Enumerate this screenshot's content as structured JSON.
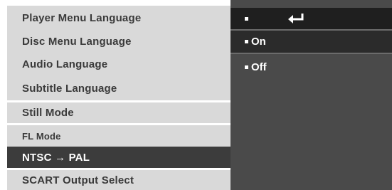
{
  "menu": {
    "items": [
      {
        "label": "Player Menu Language"
      },
      {
        "label": "Disc Menu Language"
      },
      {
        "label": "Audio Language"
      },
      {
        "label": "Subtitle Language"
      },
      {
        "label": "Still Mode"
      },
      {
        "label": "FL Mode"
      },
      {
        "label": "NTSC → PAL"
      },
      {
        "label": "SCART Output Select"
      }
    ],
    "selected_item": "NTSC → PAL"
  },
  "options": {
    "header_icon": "return-icon",
    "items": [
      {
        "label": "On"
      },
      {
        "label": "Off"
      }
    ]
  },
  "colors": {
    "selected_bg": "#3c3c3c",
    "panel_bg": "#4a4a4a",
    "menu_bg": "#d9d9d9"
  }
}
